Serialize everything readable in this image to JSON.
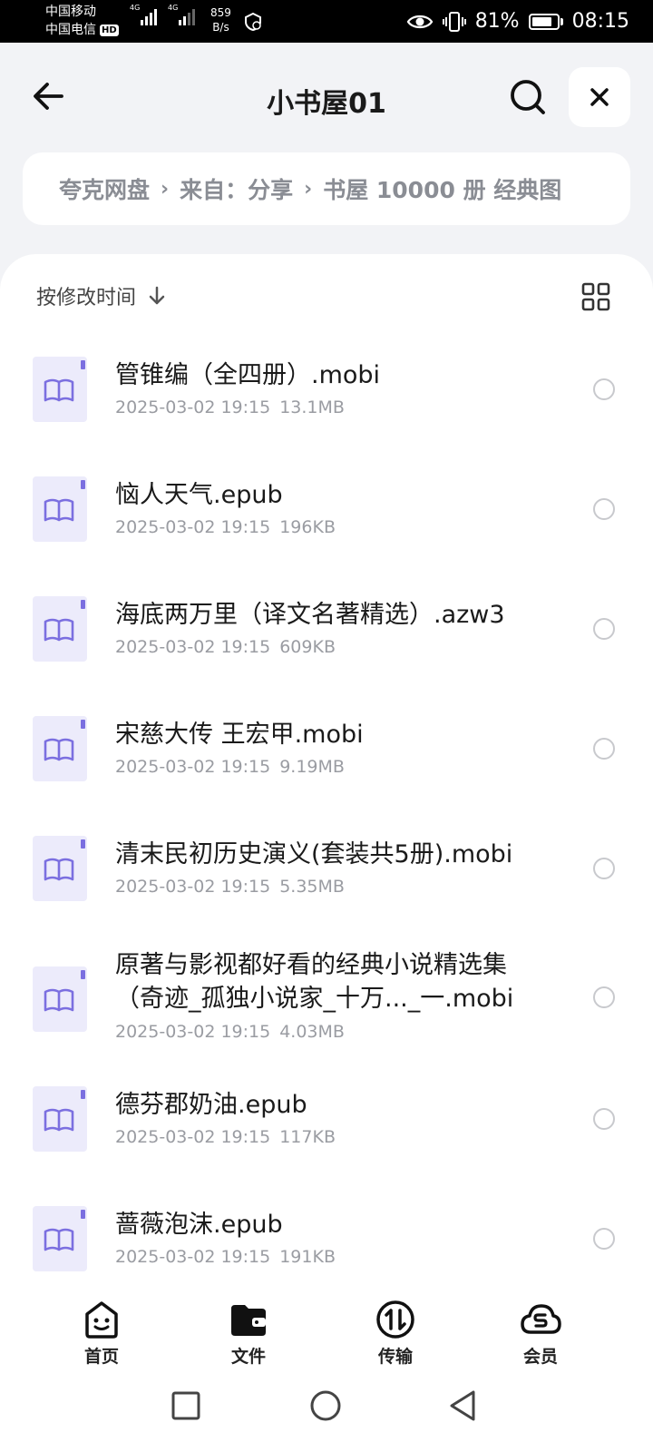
{
  "status_bar": {
    "carrier_1": "中国移动",
    "carrier_2": "中国电信",
    "hd": "HD",
    "net_1": "4G",
    "net_2": "4G",
    "speed_value": "859",
    "speed_unit": "B/s",
    "battery": "81%",
    "time": "08:15"
  },
  "header": {
    "title": "小书屋01"
  },
  "breadcrumb": {
    "items": [
      "夸克网盘",
      "来自：分享",
      "书屋 10000 册 经典图"
    ]
  },
  "sort": {
    "label": "按修改时间"
  },
  "files": [
    {
      "name": "管锥编（全四册）.mobi",
      "date": "2025-03-02 19:15",
      "size": "13.1MB"
    },
    {
      "name": "恼人天气.epub",
      "date": "2025-03-02 19:15",
      "size": "196KB"
    },
    {
      "name": "海底两万里（译文名著精选）.azw3",
      "date": "2025-03-02 19:15",
      "size": "609KB"
    },
    {
      "name": "宋慈大传 王宏甲.mobi",
      "date": "2025-03-02 19:15",
      "size": "9.19MB"
    },
    {
      "name": "清末民初历史演义(套装共5册).mobi",
      "date": "2025-03-02 19:15",
      "size": "5.35MB"
    },
    {
      "name": "原著与影视都好看的经典小说精选集（奇迹_孤独小说家_十万..._一.mobi",
      "date": "2025-03-02 19:15",
      "size": "4.03MB"
    },
    {
      "name": "德芬郡奶油.epub",
      "date": "2025-03-02 19:15",
      "size": "117KB"
    },
    {
      "name": "蔷薇泡沫.epub",
      "date": "2025-03-02 19:15",
      "size": "191KB"
    }
  ],
  "bottom_nav": {
    "home": "首页",
    "files": "文件",
    "transfer": "传输",
    "member": "会员"
  },
  "colors": {
    "book_icon_bg": "#ecebfb",
    "book_icon_accent": "#7b6fe0",
    "muted_text": "#9a9ca2",
    "page_bg": "#f2f3f6"
  }
}
